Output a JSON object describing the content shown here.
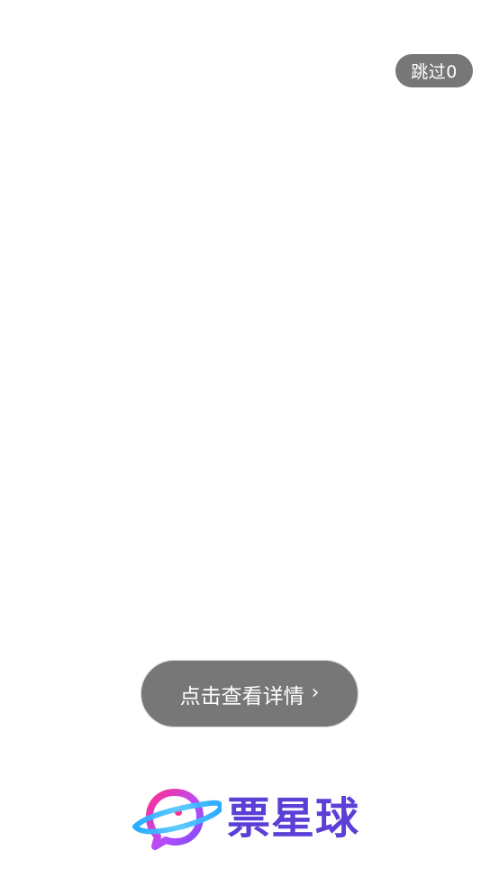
{
  "skip": {
    "label": "跳过0"
  },
  "detail_button": {
    "label": "点击查看详情",
    "icon": "chevron-right-icon"
  },
  "logo": {
    "text": "票星球",
    "icon": "planet-logo-icon",
    "colors": {
      "text": "#5b3fd6",
      "pink": "#ff2d8f",
      "purple": "#8a3ff5",
      "blue": "#1ea7ff"
    }
  },
  "colors": {
    "background": "#ffffff",
    "button_bg": "#777777",
    "button_text": "#ffffff"
  }
}
